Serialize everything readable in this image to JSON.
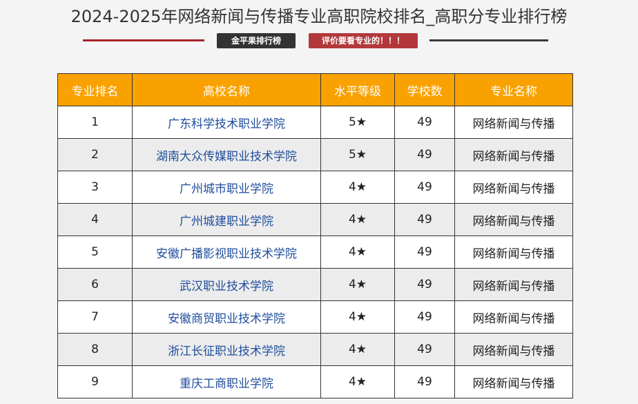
{
  "page": {
    "title": "2024-2025年网络新闻与传播专业高职院校排名_高职分专业排行榜",
    "badge_left": "金平果排行榜",
    "badge_right": "评价要看专业的！！！"
  },
  "table": {
    "headers": [
      "专业排名",
      "高校名称",
      "水平等级",
      "学校数",
      "专业名称"
    ],
    "rows": [
      {
        "rank": "1",
        "school": "广东科学技术职业学院",
        "level": "5★",
        "count": "49",
        "major": "网络新闻与传播"
      },
      {
        "rank": "2",
        "school": "湖南大众传媒职业技术学院",
        "level": "5★",
        "count": "49",
        "major": "网络新闻与传播"
      },
      {
        "rank": "3",
        "school": "广州城市职业学院",
        "level": "4★",
        "count": "49",
        "major": "网络新闻与传播"
      },
      {
        "rank": "4",
        "school": "广州城建职业学院",
        "level": "4★",
        "count": "49",
        "major": "网络新闻与传播"
      },
      {
        "rank": "5",
        "school": "安徽广播影视职业技术学院",
        "level": "4★",
        "count": "49",
        "major": "网络新闻与传播"
      },
      {
        "rank": "6",
        "school": "武汉职业技术学院",
        "level": "4★",
        "count": "49",
        "major": "网络新闻与传播"
      },
      {
        "rank": "7",
        "school": "安徽商贸职业技术学院",
        "level": "4★",
        "count": "49",
        "major": "网络新闻与传播"
      },
      {
        "rank": "8",
        "school": "浙江长征职业技术学院",
        "level": "4★",
        "count": "49",
        "major": "网络新闻与传播"
      },
      {
        "rank": "9",
        "school": "重庆工商职业学院",
        "level": "4★",
        "count": "49",
        "major": "网络新闻与传播"
      }
    ]
  },
  "colors": {
    "header_bg": "#f9a100",
    "link": "#1f4e9c",
    "accent_red": "#a8232a",
    "badge_dark": "#333333",
    "badge_red": "#b2383b"
  }
}
